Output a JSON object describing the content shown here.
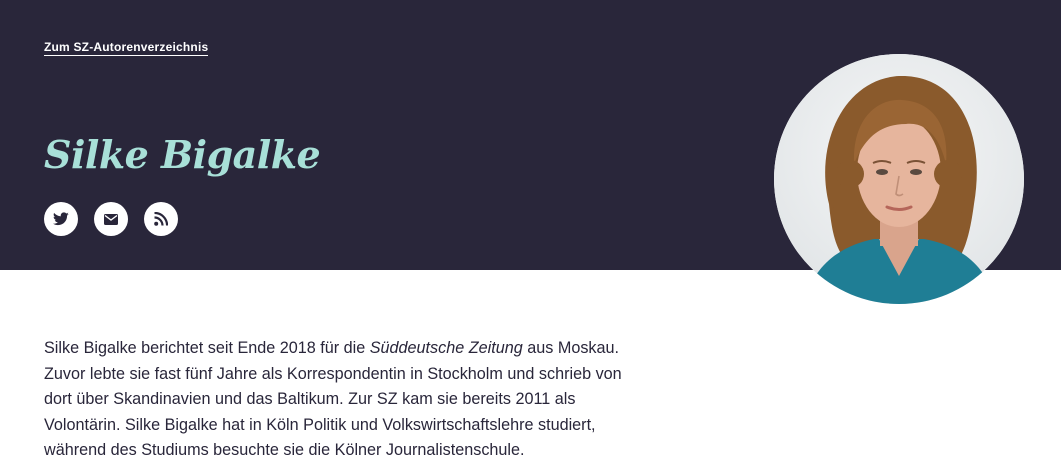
{
  "header": {
    "back_link": "Zum SZ-Autorenverzeichnis",
    "author_name": "Silke Bigalke",
    "background_color": "#29263a",
    "name_color": "#a8e0d8"
  },
  "social": [
    {
      "icon": "twitter-icon"
    },
    {
      "icon": "mail-icon"
    },
    {
      "icon": "rss-icon"
    }
  ],
  "portrait": {
    "description_icon": "author-portrait"
  },
  "bio": {
    "part1": "Silke Bigalke berichtet seit Ende 2018 für die ",
    "publication": "Süddeutsche Zeitung",
    "part2": " aus Moskau. Zuvor lebte sie fast fünf Jahre als Korrespondentin in Stockholm und schrieb von dort über Skandinavien und das Baltikum. Zur SZ kam sie bereits 2011 als Volontärin. Silke Bigalke hat in Köln Politik und Volkswirtschaftslehre studiert, während des Studiums besuchte sie die Kölner Journalistenschule."
  }
}
